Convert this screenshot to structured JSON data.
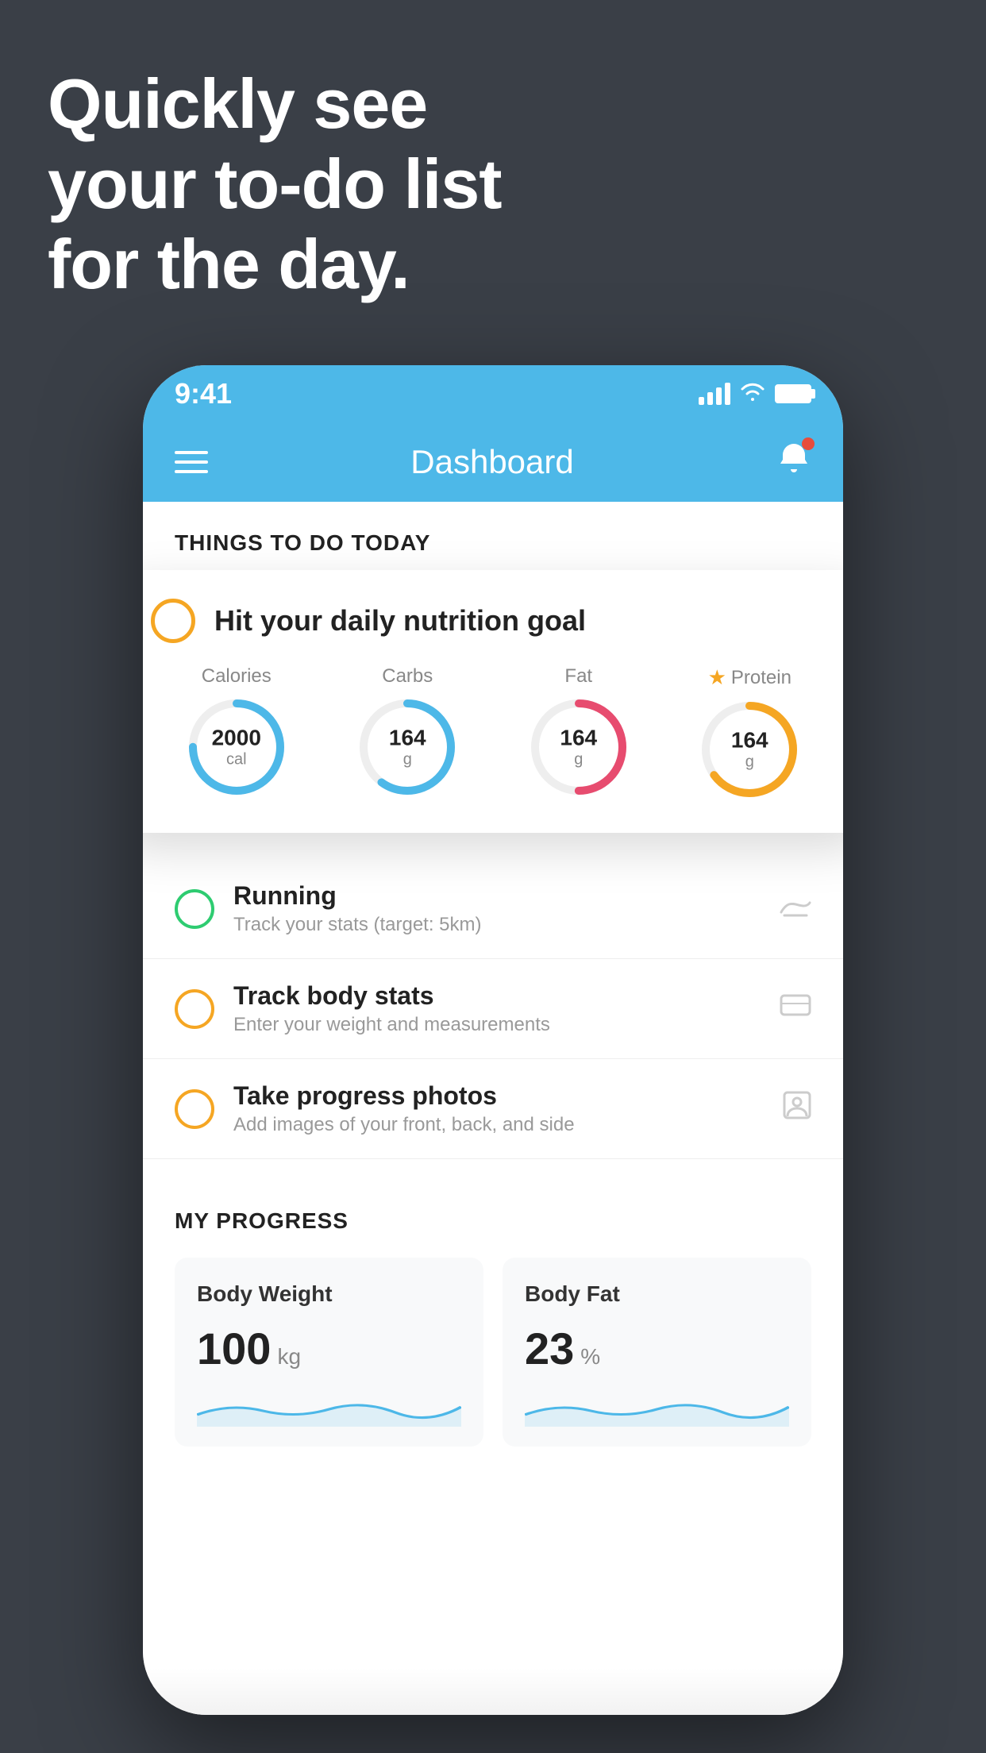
{
  "headline": {
    "line1": "Quickly see",
    "line2": "your to-do list",
    "line3": "for the day."
  },
  "status_bar": {
    "time": "9:41"
  },
  "header": {
    "title": "Dashboard"
  },
  "things_to_do": {
    "section_label": "THINGS TO DO TODAY"
  },
  "nutrition_card": {
    "title": "Hit your daily nutrition goal",
    "stats": [
      {
        "label": "Calories",
        "value": "2000",
        "unit": "cal",
        "color": "#4db8e8",
        "track": 75,
        "starred": false
      },
      {
        "label": "Carbs",
        "value": "164",
        "unit": "g",
        "color": "#4db8e8",
        "track": 60,
        "starred": false
      },
      {
        "label": "Fat",
        "value": "164",
        "unit": "g",
        "color": "#e74c6f",
        "track": 50,
        "starred": false
      },
      {
        "label": "Protein",
        "value": "164",
        "unit": "g",
        "color": "#f5a623",
        "track": 65,
        "starred": true
      }
    ]
  },
  "todo_items": [
    {
      "title": "Running",
      "subtitle": "Track your stats (target: 5km)",
      "circle_color": "green",
      "icon": "🏃"
    },
    {
      "title": "Track body stats",
      "subtitle": "Enter your weight and measurements",
      "circle_color": "yellow",
      "icon": "⚖"
    },
    {
      "title": "Take progress photos",
      "subtitle": "Add images of your front, back, and side",
      "circle_color": "yellow",
      "icon": "👤"
    }
  ],
  "progress": {
    "section_label": "MY PROGRESS",
    "cards": [
      {
        "title": "Body Weight",
        "value": "100",
        "unit": "kg"
      },
      {
        "title": "Body Fat",
        "value": "23",
        "unit": "%"
      }
    ]
  }
}
